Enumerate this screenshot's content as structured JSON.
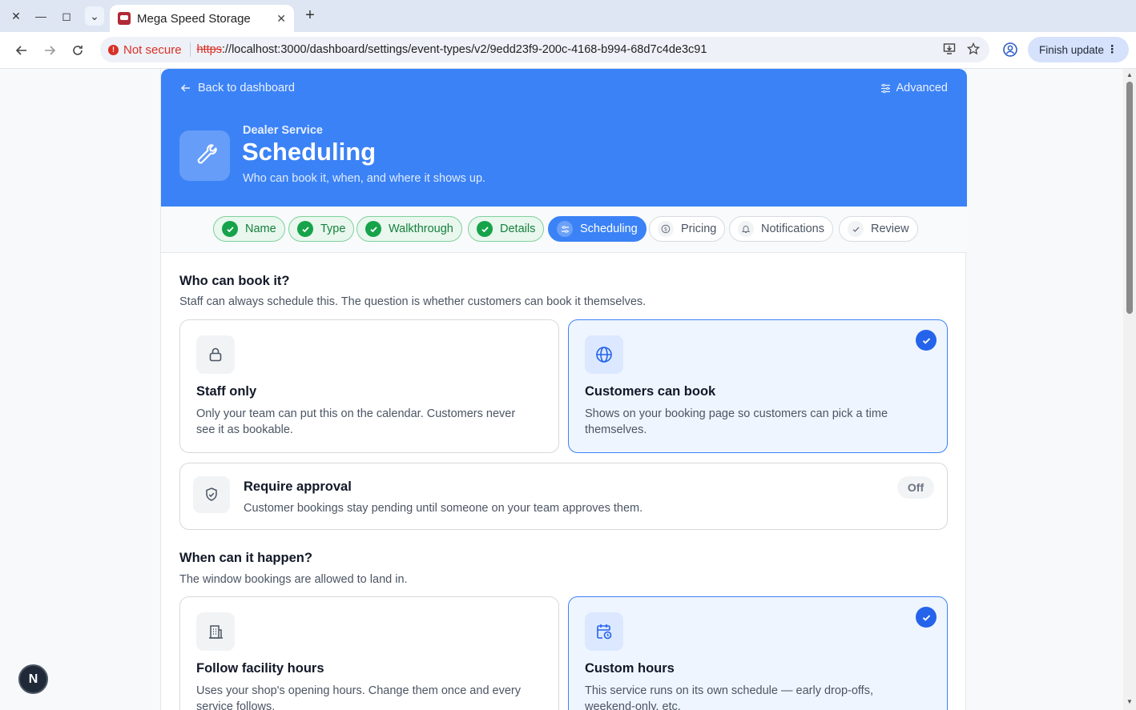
{
  "browser": {
    "tab_title": "Mega Speed Storage",
    "not_secure": "Not secure",
    "url_scheme": "https",
    "url_rest": "://localhost:3000/dashboard/settings/event-types/v2/9edd23f9-200c-4168-b994-68d7c4de3c91",
    "finish_update": "Finish update"
  },
  "header": {
    "back_label": "Back to dashboard",
    "advanced_label": "Advanced",
    "eyebrow": "Dealer Service",
    "title": "Scheduling",
    "subtitle": "Who can book it, when, and where it shows up.",
    "icon": "wrench-icon"
  },
  "steps": [
    {
      "label": "Name",
      "state": "done"
    },
    {
      "label": "Type",
      "state": "done"
    },
    {
      "label": "Walkthrough",
      "state": "done"
    },
    {
      "label": "Details",
      "state": "done"
    },
    {
      "label": "Scheduling",
      "state": "active"
    },
    {
      "label": "Pricing",
      "state": "todo"
    },
    {
      "label": "Notifications",
      "state": "todo"
    },
    {
      "label": "Review",
      "state": "todo"
    }
  ],
  "who": {
    "title": "Who can book it?",
    "subtitle": "Staff can always schedule this. The question is whether customers can book it themselves.",
    "options": [
      {
        "title": "Staff only",
        "desc": "Only your team can put this on the calendar. Customers never see it as bookable.",
        "icon": "lock-icon",
        "selected": false
      },
      {
        "title": "Customers can book",
        "desc": "Shows on your booking page so customers can pick a time themselves.",
        "icon": "globe-icon",
        "selected": true
      }
    ]
  },
  "approval": {
    "title": "Require approval",
    "desc": "Customer bookings stay pending until someone on your team approves them.",
    "state": "Off"
  },
  "when": {
    "title": "When can it happen?",
    "subtitle": "The window bookings are allowed to land in.",
    "options": [
      {
        "title": "Follow facility hours",
        "desc": "Uses your shop's opening hours. Change them once and every service follows.",
        "icon": "building-icon",
        "selected": false
      },
      {
        "title": "Custom hours",
        "desc": "This service runs on its own schedule — early drop-offs, weekend-only, etc.",
        "icon": "calendar-clock-icon",
        "selected": true
      }
    ]
  },
  "fab_label": "N",
  "colors": {
    "brand": "#3b82f6",
    "done": "#16a34a",
    "selected_check": "#2563eb"
  }
}
